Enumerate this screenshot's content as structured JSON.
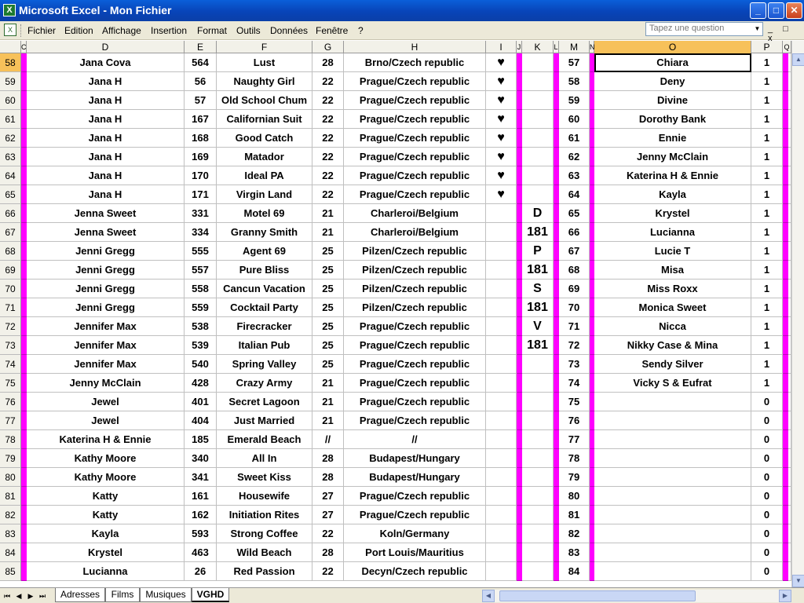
{
  "window": {
    "title": "Microsoft Excel - Mon Fichier",
    "app_icon_label": "X"
  },
  "window_controls": {
    "minimize": "_",
    "maximize": "□",
    "close": "✕"
  },
  "menu": {
    "items": [
      "Fichier",
      "Edition",
      "Affichage",
      "Insertion",
      "Format",
      "Outils",
      "Données",
      "Fenêtre",
      "?"
    ],
    "question_placeholder": "Tapez une question",
    "mini_controls": "_ □ x"
  },
  "columns": [
    "C",
    "D",
    "E",
    "F",
    "G",
    "H",
    "I",
    "J",
    "K",
    "L",
    "M",
    "N",
    "O",
    "P",
    "Q"
  ],
  "active_column": "O",
  "active_row": "58",
  "selected_cell": "O58",
  "rows": [
    {
      "n": "58",
      "d": "Jana Cova",
      "e": "564",
      "f": "Lust",
      "g": "28",
      "h": "Brno/Czech republic",
      "i": "♥",
      "k": "",
      "m": "57",
      "o": "Chiara",
      "p": "1"
    },
    {
      "n": "59",
      "d": "Jana H",
      "e": "56",
      "f": "Naughty Girl",
      "g": "22",
      "h": "Prague/Czech republic",
      "i": "♥",
      "k": "",
      "m": "58",
      "o": "Deny",
      "p": "1"
    },
    {
      "n": "60",
      "d": "Jana H",
      "e": "57",
      "f": "Old School Chum",
      "g": "22",
      "h": "Prague/Czech republic",
      "i": "♥",
      "k": "",
      "m": "59",
      "o": "Divine",
      "p": "1"
    },
    {
      "n": "61",
      "d": "Jana H",
      "e": "167",
      "f": "Californian Suit",
      "g": "22",
      "h": "Prague/Czech republic",
      "i": "♥",
      "k": "",
      "m": "60",
      "o": "Dorothy Bank",
      "p": "1"
    },
    {
      "n": "62",
      "d": "Jana H",
      "e": "168",
      "f": "Good Catch",
      "g": "22",
      "h": "Prague/Czech republic",
      "i": "♥",
      "k": "",
      "m": "61",
      "o": "Ennie",
      "p": "1"
    },
    {
      "n": "63",
      "d": "Jana H",
      "e": "169",
      "f": "Matador",
      "g": "22",
      "h": "Prague/Czech republic",
      "i": "♥",
      "k": "",
      "m": "62",
      "o": "Jenny McClain",
      "p": "1"
    },
    {
      "n": "64",
      "d": "Jana H",
      "e": "170",
      "f": "Ideal PA",
      "g": "22",
      "h": "Prague/Czech republic",
      "i": "♥",
      "k": "",
      "m": "63",
      "o": "Katerina H & Ennie",
      "p": "1"
    },
    {
      "n": "65",
      "d": "Jana H",
      "e": "171",
      "f": "Virgin Land",
      "g": "22",
      "h": "Prague/Czech republic",
      "i": "♥",
      "k": "",
      "m": "64",
      "o": "Kayla",
      "p": "1"
    },
    {
      "n": "66",
      "d": "Jenna Sweet",
      "e": "331",
      "f": "Motel 69",
      "g": "21",
      "h": "Charleroi/Belgium",
      "i": "",
      "k": "D",
      "m": "65",
      "o": "Krystel",
      "p": "1"
    },
    {
      "n": "67",
      "d": "Jenna Sweet",
      "e": "334",
      "f": "Granny Smith",
      "g": "21",
      "h": "Charleroi/Belgium",
      "i": "",
      "k": "181",
      "m": "66",
      "o": "Lucianna",
      "p": "1"
    },
    {
      "n": "68",
      "d": "Jenni Gregg",
      "e": "555",
      "f": "Agent 69",
      "g": "25",
      "h": "Pilzen/Czech republic",
      "i": "",
      "k": "P",
      "m": "67",
      "o": "Lucie T",
      "p": "1"
    },
    {
      "n": "69",
      "d": "Jenni Gregg",
      "e": "557",
      "f": "Pure Bliss",
      "g": "25",
      "h": "Pilzen/Czech republic",
      "i": "",
      "k": "181",
      "m": "68",
      "o": "Misa",
      "p": "1"
    },
    {
      "n": "70",
      "d": "Jenni Gregg",
      "e": "558",
      "f": "Cancun Vacation",
      "g": "25",
      "h": "Pilzen/Czech republic",
      "i": "",
      "k": "S",
      "m": "69",
      "o": "Miss Roxx",
      "p": "1"
    },
    {
      "n": "71",
      "d": "Jenni Gregg",
      "e": "559",
      "f": "Cocktail Party",
      "g": "25",
      "h": "Pilzen/Czech republic",
      "i": "",
      "k": "181",
      "m": "70",
      "o": "Monica Sweet",
      "p": "1"
    },
    {
      "n": "72",
      "d": "Jennifer Max",
      "e": "538",
      "f": "Firecracker",
      "g": "25",
      "h": "Prague/Czech republic",
      "i": "",
      "k": "V",
      "m": "71",
      "o": "Nicca",
      "p": "1"
    },
    {
      "n": "73",
      "d": "Jennifer Max",
      "e": "539",
      "f": "Italian Pub",
      "g": "25",
      "h": "Prague/Czech republic",
      "i": "",
      "k": "181",
      "m": "72",
      "o": "Nikky Case & Mina",
      "p": "1"
    },
    {
      "n": "74",
      "d": "Jennifer Max",
      "e": "540",
      "f": "Spring Valley",
      "g": "25",
      "h": "Prague/Czech republic",
      "i": "",
      "k": "",
      "m": "73",
      "o": "Sendy Silver",
      "p": "1"
    },
    {
      "n": "75",
      "d": "Jenny McClain",
      "e": "428",
      "f": "Crazy Army",
      "g": "21",
      "h": "Prague/Czech republic",
      "i": "",
      "k": "",
      "m": "74",
      "o": "Vicky S & Eufrat",
      "p": "1"
    },
    {
      "n": "76",
      "d": "Jewel",
      "e": "401",
      "f": "Secret Lagoon",
      "g": "21",
      "h": "Prague/Czech republic",
      "i": "",
      "k": "",
      "m": "75",
      "o": "",
      "p": "0"
    },
    {
      "n": "77",
      "d": "Jewel",
      "e": "404",
      "f": "Just Married",
      "g": "21",
      "h": "Prague/Czech republic",
      "i": "",
      "k": "",
      "m": "76",
      "o": "",
      "p": "0"
    },
    {
      "n": "78",
      "d": "Katerina H & Ennie",
      "e": "185",
      "f": "Emerald Beach",
      "g": "//",
      "h": "//",
      "i": "",
      "k": "",
      "m": "77",
      "o": "",
      "p": "0"
    },
    {
      "n": "79",
      "d": "Kathy Moore",
      "e": "340",
      "f": "All In",
      "g": "28",
      "h": "Budapest/Hungary",
      "i": "",
      "k": "",
      "m": "78",
      "o": "",
      "p": "0"
    },
    {
      "n": "80",
      "d": "Kathy Moore",
      "e": "341",
      "f": "Sweet Kiss",
      "g": "28",
      "h": "Budapest/Hungary",
      "i": "",
      "k": "",
      "m": "79",
      "o": "",
      "p": "0"
    },
    {
      "n": "81",
      "d": "Katty",
      "e": "161",
      "f": "Housewife",
      "g": "27",
      "h": "Prague/Czech republic",
      "i": "",
      "k": "",
      "m": "80",
      "o": "",
      "p": "0"
    },
    {
      "n": "82",
      "d": "Katty",
      "e": "162",
      "f": "Initiation Rites",
      "g": "27",
      "h": "Prague/Czech republic",
      "i": "",
      "k": "",
      "m": "81",
      "o": "",
      "p": "0"
    },
    {
      "n": "83",
      "d": "Kayla",
      "e": "593",
      "f": "Strong Coffee",
      "g": "22",
      "h": "Koln/Germany",
      "i": "",
      "k": "",
      "m": "82",
      "o": "",
      "p": "0"
    },
    {
      "n": "84",
      "d": "Krystel",
      "e": "463",
      "f": "Wild Beach",
      "g": "28",
      "h": "Port Louis/Mauritius",
      "i": "",
      "k": "",
      "m": "83",
      "o": "",
      "p": "0"
    },
    {
      "n": "85",
      "d": "Lucianna",
      "e": "26",
      "f": "Red Passion",
      "g": "22",
      "h": "Decyn/Czech republic",
      "i": "",
      "k": "",
      "m": "84",
      "o": "",
      "p": "0"
    }
  ],
  "sheet_tabs": [
    "Adresses",
    "Films",
    "Musiques",
    "VGHD"
  ],
  "active_sheet": "VGHD",
  "colors": {
    "magenta": "#ff00ff",
    "active_header": "#f7c15a",
    "titlebar": "#0a5fd9"
  },
  "icons": [
    "excel-app-icon",
    "minimize-icon",
    "maximize-icon",
    "close-icon",
    "scroll-arrow-icon",
    "sheet-nav-icon"
  ]
}
